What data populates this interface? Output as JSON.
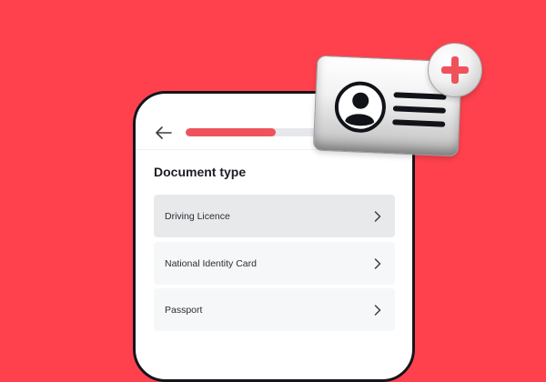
{
  "header": {
    "back_icon": "arrow-left-icon",
    "progress": 0.43
  },
  "main": {
    "title": "Document type",
    "options": [
      {
        "label": "Driving Licence",
        "selected": true
      },
      {
        "label": "National Identity Card",
        "selected": false
      },
      {
        "label": "Passport",
        "selected": false
      }
    ]
  },
  "illustration": {
    "card_icon": "id-card-icon",
    "badge_icon": "plus-icon"
  },
  "colors": {
    "background": "#FF414E",
    "accent": "#F0525C",
    "selected_row": "#E8E9EB"
  }
}
